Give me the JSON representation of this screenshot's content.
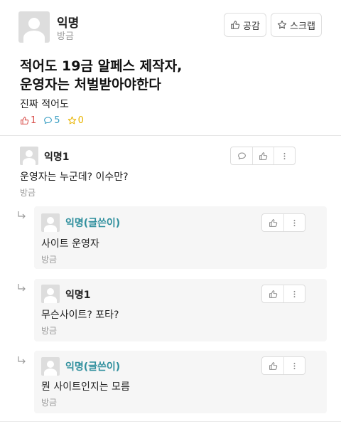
{
  "post": {
    "author": "익명",
    "time": "방금",
    "like_label": "공감",
    "scrap_label": "스크랩",
    "title": "적어도 19금 알페스 제작자,\n운영자는 처벌받아야한다",
    "body": "진짜 적어도",
    "stats": {
      "likes": "1",
      "comments": "5",
      "scraps": "0"
    }
  },
  "comments": [
    {
      "author": "익명1",
      "text": "운영자는 누군데? 이수만?",
      "time": "방금"
    }
  ],
  "replies": [
    {
      "author": "익명(글쓴이)",
      "text": "사이트 운영자",
      "time": "방금",
      "is_writer": true
    },
    {
      "author": "익명1",
      "text": "무슨사이트? 포타?",
      "time": "방금",
      "is_writer": false
    },
    {
      "author": "익명(글쓴이)",
      "text": "뭔 사이트인지는 모름",
      "time": "방금",
      "is_writer": true
    }
  ],
  "colors": {
    "like_red": "#d9534f",
    "comment_blue": "#3da0c4",
    "scrap_yellow": "#e8b400",
    "writer_teal": "#2f8f9d"
  },
  "icons": [
    "thumbs-up-icon",
    "star-icon",
    "chat-bubble-icon",
    "more-vertical-icon",
    "reply-arrow-icon",
    "avatar-placeholder-icon"
  ]
}
